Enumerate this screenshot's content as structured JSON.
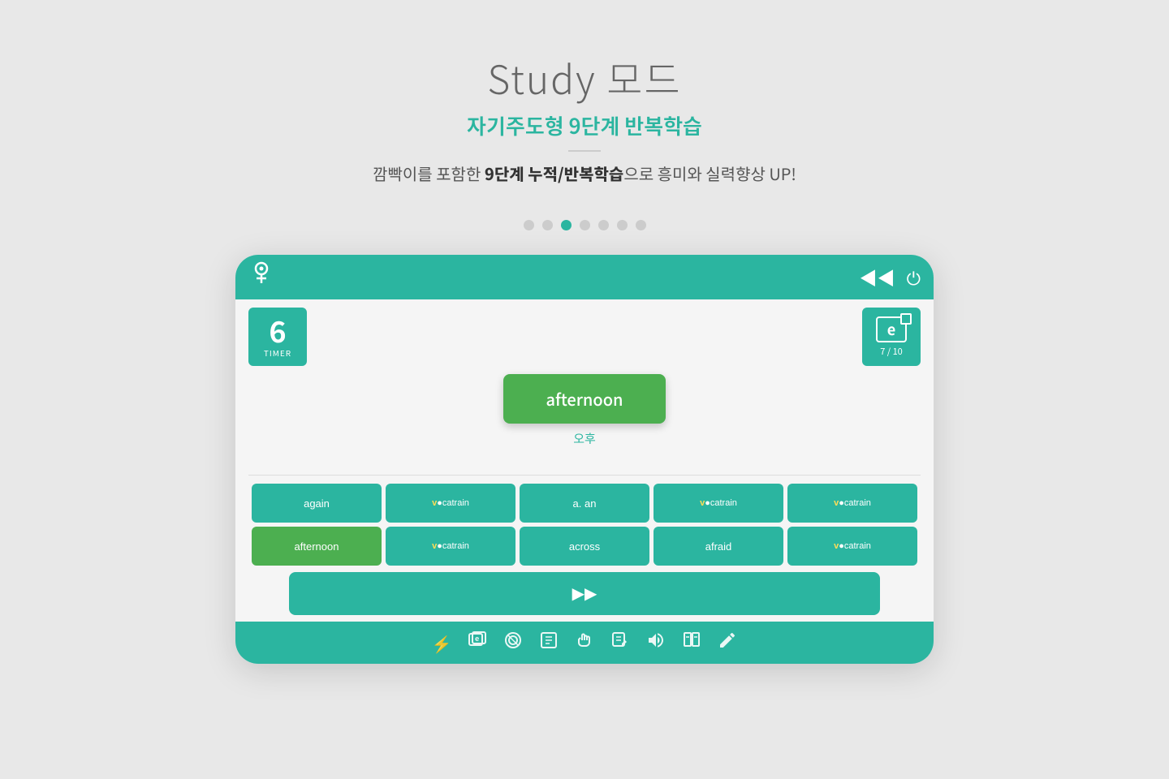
{
  "header": {
    "title": "Study 모드",
    "subtitle": "자기주도형 9단계 반복학습",
    "description_prefix": "깜빡이를 포함한 ",
    "description_bold": "9단계 누적/반복학습",
    "description_suffix": "으로 흥미와 실력향상 UP!"
  },
  "dots": {
    "total": 7,
    "active_index": 2
  },
  "app": {
    "logo": "ô",
    "header_back_icon": "◀◀",
    "header_power_icon": "⏻"
  },
  "timer": {
    "value": "6",
    "label": "TIMER"
  },
  "progress": {
    "current": 7,
    "total": 10,
    "display": "7 / 10"
  },
  "flashcard": {
    "word": "afternoon",
    "translation": "오후"
  },
  "word_grid": {
    "row1": [
      {
        "label": "again",
        "type": "text",
        "selected": false
      },
      {
        "label": "vocatrain",
        "type": "voca",
        "selected": false
      },
      {
        "label": "a. an",
        "type": "text",
        "selected": false
      },
      {
        "label": "vocatrain",
        "type": "voca",
        "selected": false
      },
      {
        "label": "vocatrain",
        "type": "voca",
        "selected": false
      }
    ],
    "row2": [
      {
        "label": "afternoon",
        "type": "text",
        "selected": true
      },
      {
        "label": "vocatrain",
        "type": "voca",
        "selected": false
      },
      {
        "label": "across",
        "type": "text",
        "selected": false
      },
      {
        "label": "afraid",
        "type": "text",
        "selected": false
      },
      {
        "label": "vocatrain",
        "type": "voca",
        "selected": false
      }
    ]
  },
  "next_button": {
    "icon": "▶▶"
  },
  "toolbar": {
    "icons": [
      "⚡",
      "e",
      "🎧",
      "📖",
      "✋",
      "📝",
      "🎧",
      "📖",
      "✏️"
    ]
  }
}
